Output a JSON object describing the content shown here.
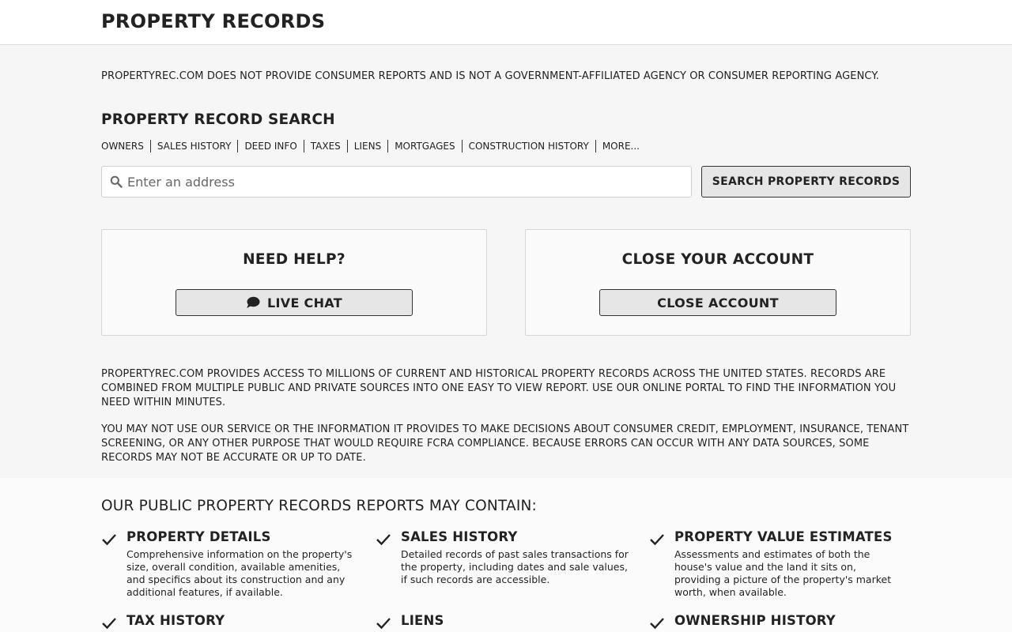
{
  "header": {
    "brand": "PROPERTY RECORDS"
  },
  "disclaimer": "PROPERTYREC.COM DOES NOT PROVIDE CONSUMER REPORTS AND IS NOT A GOVERNMENT-AFFILIATED AGENCY OR CONSUMER REPORTING AGENCY.",
  "search": {
    "title": "PROPERTY RECORD SEARCH",
    "tabs": [
      "OWNERS",
      "SALES HISTORY",
      "DEED INFO",
      "TAXES",
      "LIENS",
      "MORTGAGES",
      "CONSTRUCTION HISTORY",
      "MORE..."
    ],
    "placeholder": "Enter an address",
    "value": "",
    "button_label": "SEARCH PROPERTY RECORDS",
    "icon": "search-icon"
  },
  "help_card": {
    "title": "NEED HELP?",
    "button_label": "LIVE CHAT",
    "icon": "chat-icon"
  },
  "close_card": {
    "title": "CLOSE YOUR ACCOUNT",
    "button_label": "CLOSE ACCOUNT"
  },
  "paragraphs": [
    "PROPERTYREC.COM PROVIDES ACCESS TO MILLIONS OF CURRENT AND HISTORICAL PROPERTY RECORDS ACROSS THE UNITED STATES. RECORDS ARE COMBINED FROM MULTIPLE PUBLIC AND PRIVATE SOURCES INTO ONE EASY TO VIEW REPORT. USE OUR ONLINE PORTAL TO FIND THE INFORMATION YOU NEED WITHIN MINUTES.",
    "YOU MAY NOT USE OUR SERVICE OR THE INFORMATION IT PROVIDES TO MAKE DECISIONS ABOUT CONSUMER CREDIT, EMPLOYMENT, INSURANCE, TENANT SCREENING, OR ANY OTHER PURPOSE THAT WOULD REQUIRE FCRA COMPLIANCE. BECAUSE ERRORS CAN OCCUR WITH ANY DATA SOURCES, SOME RECORDS MAY NOT BE ACCURATE OR UP TO DATE."
  ],
  "contains": {
    "title": "OUR PUBLIC PROPERTY RECORDS REPORTS MAY CONTAIN:",
    "icon": "check-icon",
    "features": [
      {
        "title": "PROPERTY DETAILS",
        "description": "Comprehensive information on the property's size, overall condition, available amenities, and specifics about its construction and any additional features, if available."
      },
      {
        "title": "SALES HISTORY",
        "description": "Detailed records of past sales transactions for the property, including dates and sale values, if such records are accessible."
      },
      {
        "title": "PROPERTY VALUE ESTIMATES",
        "description": "Assessments and estimates of both the house's value and the land it sits on, providing a picture of the property's market worth, when available."
      },
      {
        "title": "TAX HISTORY",
        "description": ""
      },
      {
        "title": "LIENS",
        "description": ""
      },
      {
        "title": "OWNERSHIP HISTORY",
        "description": ""
      }
    ]
  }
}
